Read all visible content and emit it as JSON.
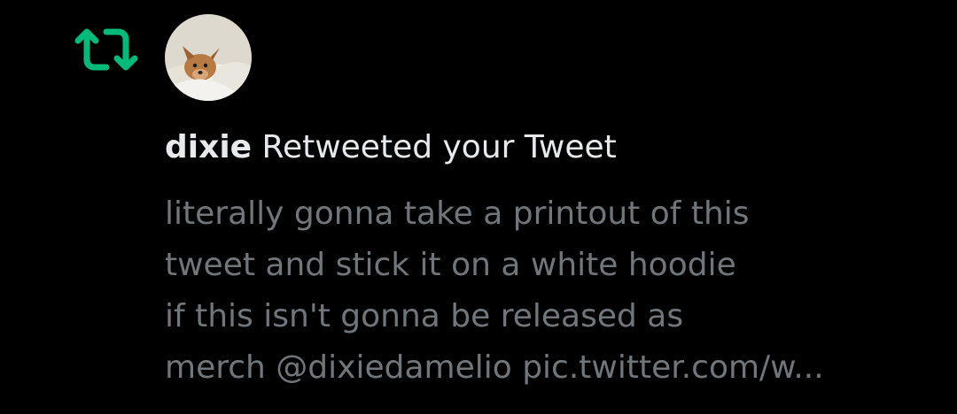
{
  "notification": {
    "icon": "retweet-icon",
    "accent_color": "#00ba7c",
    "avatar": "dog-avatar",
    "user_name": "dixie",
    "action_text": "Retweeted your Tweet",
    "tweet_lines": [
      "literally gonna take a printout of this",
      "tweet and stick it on a white hoodie",
      "if this isn't gonna be released as",
      "merch  @dixiedamelio pic.twitter.com/w..."
    ]
  }
}
